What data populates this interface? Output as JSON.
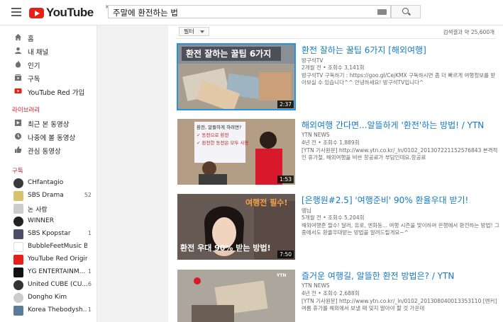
{
  "header": {
    "logo_text": "YouTube",
    "region": "KR",
    "search_value": "주말에 환전하는 법"
  },
  "sidebar": {
    "main_items": [
      {
        "label": "홈",
        "icon": "home-icon"
      },
      {
        "label": "내 채널",
        "icon": "person-icon"
      },
      {
        "label": "인기",
        "icon": "flame-icon"
      },
      {
        "label": "구독",
        "icon": "subscriptions-icon"
      },
      {
        "label": "YouTube Red 가입",
        "icon": "youtube-red-icon"
      }
    ],
    "library_title": "라이브러리",
    "library_items": [
      {
        "label": "최근 본 동영상",
        "icon": "history-icon"
      },
      {
        "label": "나중에 볼 동영상",
        "icon": "clock-icon"
      },
      {
        "label": "관심 동영상",
        "icon": "thumbs-up-icon"
      }
    ],
    "subs_title": "구독",
    "subscriptions": [
      {
        "label": "CHfantagio",
        "count": ""
      },
      {
        "label": "SBS Drama",
        "count": "52"
      },
      {
        "label": "논 사랑",
        "count": ""
      },
      {
        "label": "WINNER",
        "count": ""
      },
      {
        "label": "SBS Kpopstar",
        "count": "1"
      },
      {
        "label": "BubbleFeetMusic Blas...",
        "count": ""
      },
      {
        "label": "YouTube Red Originals",
        "count": ""
      },
      {
        "label": "YG ENTERTAINM...",
        "count": "1"
      },
      {
        "label": "United CUBE (CU...",
        "count": "6"
      },
      {
        "label": "Dongho Kim",
        "count": ""
      },
      {
        "label": "Korea Thebodysh...",
        "count": "1"
      }
    ]
  },
  "main": {
    "filter_label": "필터",
    "result_count": "검색결과 약 25,600개",
    "results": [
      {
        "title": "환전 잘하는 꿀팁 6가지 [해외여행]",
        "channel": "방구석TV",
        "meta": "2개월 전 • 조회수 3,141회",
        "desc": "방구석TV 구독하기 : https://goo.gl/CejKMX 구독하시면 좀 더 빠르게 여행정보를 받아보실 수 있습니다^^ 안녕하세요! 방구석TV입니다^",
        "duration": "2:37",
        "thumb_text": "환전 잘하는 꿀팁 6가지"
      },
      {
        "title": "해외여행 간다면...알뜰하게 '환전'하는 방법! / YTN",
        "channel": "YTN NEWS",
        "meta": "4년 전 • 조회수 1,889회",
        "desc": "[YTN 기사원문] http://www.ytn.co.kr/_ln/0102_201307221152576843 본격적인 휴가철, 해외여행을 비싼 항공료가 부담인데요.항공료",
        "duration": "1:53",
        "thumb_lines": [
          "환전, 알뜰하게 하려면?",
          "✓ 동전으로 환전",
          "✓ 환전한 동전은 모두 사용"
        ]
      },
      {
        "title": "[은행원#2.5] '여행준비' 90% 환율우대 받기!",
        "channel": "땡님",
        "meta": "5개월 전 • 조회수 5,204회",
        "desc": "해외여행준 필수! 달러, 유로, 엔화등... 여행 시즌을 맞이하여 은행에서 환전하는 방법! 그중에서도 환율우대받는 방법을 알려드릴게요~^",
        "duration": "7:50",
        "thumb_top": "여행전 필수!",
        "thumb_bottom": "환전 우대 90% 받는 방법!"
      },
      {
        "title": "즐거운 여행길, 알뜰한 환전 방법은? / YTN",
        "channel": "YTN NEWS",
        "meta": "4년 전 • 조회수 2,688회",
        "desc": "[YTN 기사원문] http://www.ytn.co.kr/_ln/0102_201308040013353110 [멘커] 여름 휴가를 해외에서 보낼 때 잊지 말아야 할 것 가운데",
        "duration": "",
        "thumb_logo": "YTN"
      }
    ]
  },
  "colors": {
    "accent_red": "#e62117",
    "link_blue": "#167ac6",
    "section_red": "#cc181e"
  }
}
